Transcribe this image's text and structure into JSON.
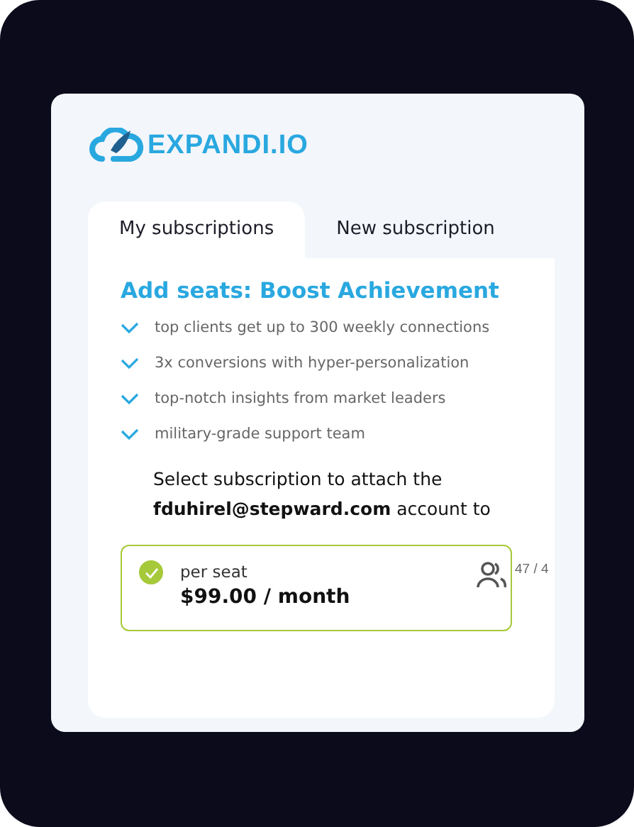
{
  "logo": {
    "text": "EXPANDI.IO"
  },
  "tabs": [
    {
      "label": "My subscriptions",
      "selected": true
    },
    {
      "label": "New subscription",
      "selected": false
    }
  ],
  "heading": "Add seats: Boost Achievement",
  "features": [
    "top clients get up to 300 weekly connections",
    "3x conversions with hyper-personalization",
    "top-notch insights from market leaders",
    "military-grade support team"
  ],
  "prompt": "Select subscription to attach the **fduhirel@stepward.com** account to",
  "subscriptions": [
    {
      "label": "per seat",
      "price": "$99.00 / month",
      "seats": "47 / 4",
      "selected": true
    }
  ]
}
